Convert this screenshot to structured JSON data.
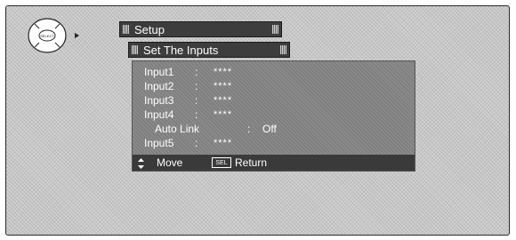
{
  "remote": {
    "center_label": "SELECT",
    "arrow": "right-arrow-icon"
  },
  "menu": {
    "title": "Setup",
    "submenu": "Set The Inputs"
  },
  "inputs": [
    {
      "label": "Input1",
      "sep": ":",
      "value": "****"
    },
    {
      "label": "Input2",
      "sep": ":",
      "value": "****"
    },
    {
      "label": "Input3",
      "sep": ":",
      "value": "****"
    },
    {
      "label": "Input4",
      "sep": ":",
      "value": "****"
    },
    {
      "label": "Auto Link",
      "sep": ":",
      "value": "Off"
    },
    {
      "label": "Input5",
      "sep": ":",
      "value": "****"
    }
  ],
  "footer": {
    "move_label": "Move",
    "sel_label": "SEL",
    "return_label": "Return"
  },
  "colors": {
    "bar": "#3d3d3d",
    "panel": "#8a8a8a",
    "text": "#ffffff"
  }
}
